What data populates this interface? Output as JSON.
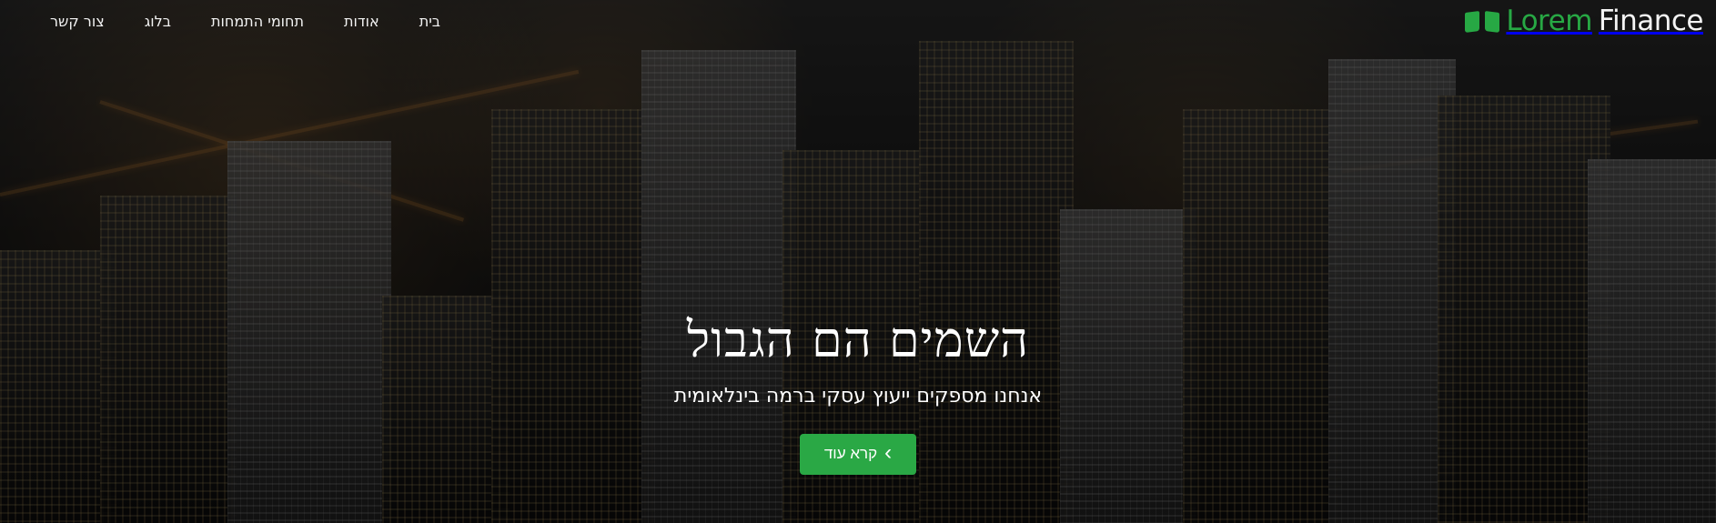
{
  "brand": {
    "lorem": "Lorem",
    "finance": "Finance"
  },
  "nav": {
    "items": [
      "צור קשר",
      "בלוג",
      "תחומי התמחות",
      "אודות",
      "בית"
    ]
  },
  "hero": {
    "title": "השמים הם הגבול",
    "subtitle": "אנחנו מספקים ייעוץ עסקי ברמה בינלאומית",
    "button_label": "קרא עוד",
    "button_icon": "chevron-right-icon"
  },
  "colors": {
    "accent": "#27a844",
    "text": "#ffffff"
  }
}
